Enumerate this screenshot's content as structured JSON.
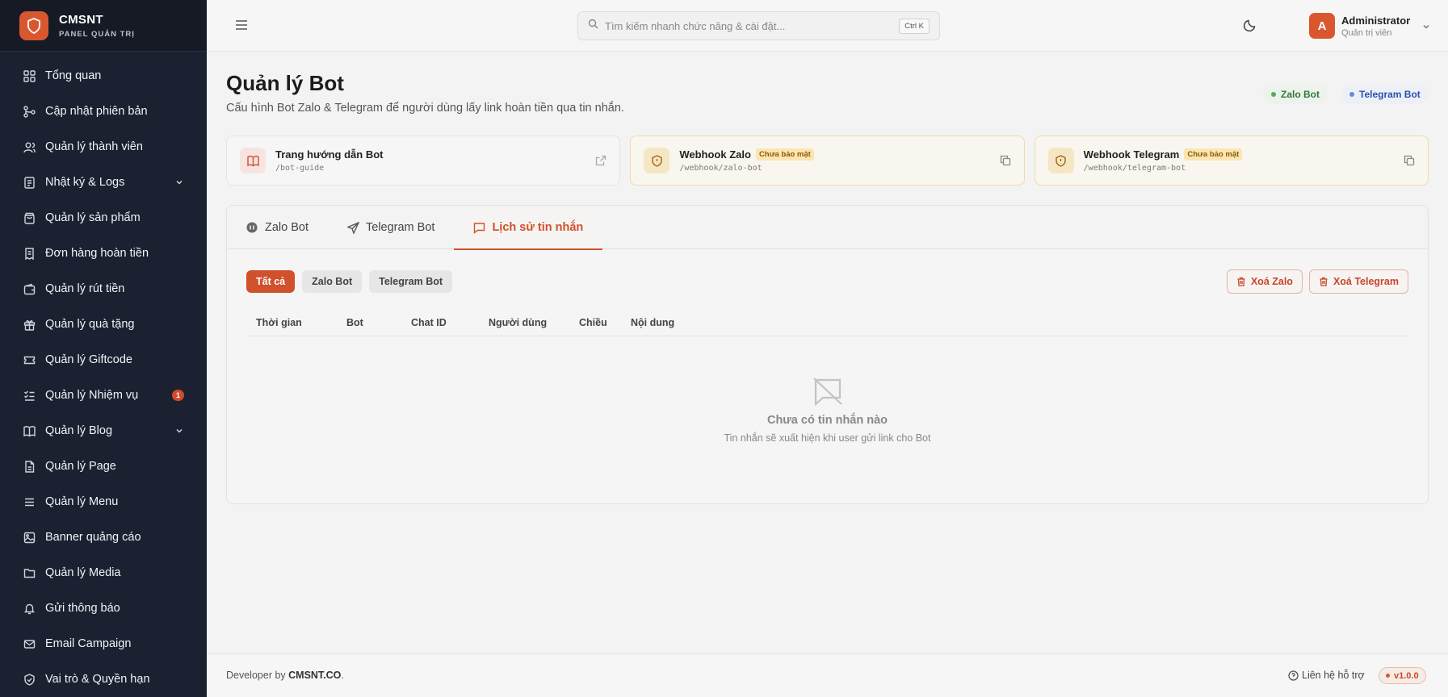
{
  "brand": {
    "name": "CMSNT",
    "subtitle": "PANEL QUẢN TRỊ"
  },
  "sidebar": {
    "items": [
      {
        "label": "Tổng quan",
        "icon": "dashboard-icon"
      },
      {
        "label": "Cập nhật phiên bản",
        "icon": "git-branch-icon"
      },
      {
        "label": "Quản lý thành viên",
        "icon": "users-icon"
      },
      {
        "label": "Nhật ký & Logs",
        "icon": "logs-icon",
        "expandable": true
      },
      {
        "label": "Quản lý sản phẩm",
        "icon": "bag-icon"
      },
      {
        "label": "Đơn hàng hoàn tiền",
        "icon": "receipt-icon"
      },
      {
        "label": "Quản lý rút tiền",
        "icon": "wallet-icon"
      },
      {
        "label": "Quản lý quà tặng",
        "icon": "gift-icon"
      },
      {
        "label": "Quản lý Giftcode",
        "icon": "ticket-icon"
      },
      {
        "label": "Quản lý Nhiệm vụ",
        "icon": "checklist-icon",
        "badge": "1"
      },
      {
        "label": "Quản lý Blog",
        "icon": "book-icon",
        "expandable": true
      },
      {
        "label": "Quản lý Page",
        "icon": "file-icon"
      },
      {
        "label": "Quản lý Menu",
        "icon": "menu-icon"
      },
      {
        "label": "Banner quảng cáo",
        "icon": "image-icon"
      },
      {
        "label": "Quản lý Media",
        "icon": "folder-icon"
      },
      {
        "label": "Gửi thông báo",
        "icon": "bell-icon"
      },
      {
        "label": "Email Campaign",
        "icon": "mail-icon"
      },
      {
        "label": "Vai trò & Quyền hạn",
        "icon": "shield-check-icon"
      }
    ]
  },
  "topbar": {
    "search_placeholder": "Tìm kiếm nhanh chức năng & cài đặt...",
    "search_shortcut": "Ctrl K",
    "user_initial": "A",
    "user_name": "Administrator",
    "user_role": "Quản trị viên"
  },
  "page": {
    "title": "Quản lý Bot",
    "subtitle": "Cấu hình Bot Zalo & Telegram để người dùng lấy link hoàn tiền qua tin nhắn.",
    "pills": {
      "zalo": "Zalo Bot",
      "telegram": "Telegram Bot"
    }
  },
  "cards": [
    {
      "title": "Trang hướng dẫn Bot",
      "path": "/bot-guide",
      "badge": ""
    },
    {
      "title": "Webhook Zalo",
      "path": "/webhook/zalo-bot",
      "badge": "Chưa bảo mật"
    },
    {
      "title": "Webhook Telegram",
      "path": "/webhook/telegram-bot",
      "badge": "Chưa bảo mật"
    }
  ],
  "tabs": [
    {
      "label": "Zalo Bot"
    },
    {
      "label": "Telegram Bot"
    },
    {
      "label": "Lịch sử tin nhắn",
      "active": true
    }
  ],
  "filters": {
    "all": "Tất cả",
    "zalo": "Zalo Bot",
    "telegram": "Telegram Bot"
  },
  "actions": {
    "delete_zalo": "Xoá Zalo",
    "delete_telegram": "Xoá Telegram"
  },
  "table": {
    "columns": [
      "Thời gian",
      "Bot",
      "Chat ID",
      "Người dùng",
      "Chiều",
      "Nội dung"
    ],
    "rows": []
  },
  "empty": {
    "title": "Chưa có tin nhắn nào",
    "subtitle": "Tin nhắn sẽ xuất hiện khi user gửi link cho Bot"
  },
  "footer": {
    "prefix": "Developer by ",
    "company": "CMSNT.CO",
    "suffix": ".",
    "support": "Liên hệ hỗ trợ",
    "version": "v1.0.0"
  },
  "colors": {
    "accent": "#d0512b",
    "sidebar_bg": "#1b2130",
    "zalo_green": "#2e7a3a",
    "telegram_blue": "#2d4fb0"
  }
}
